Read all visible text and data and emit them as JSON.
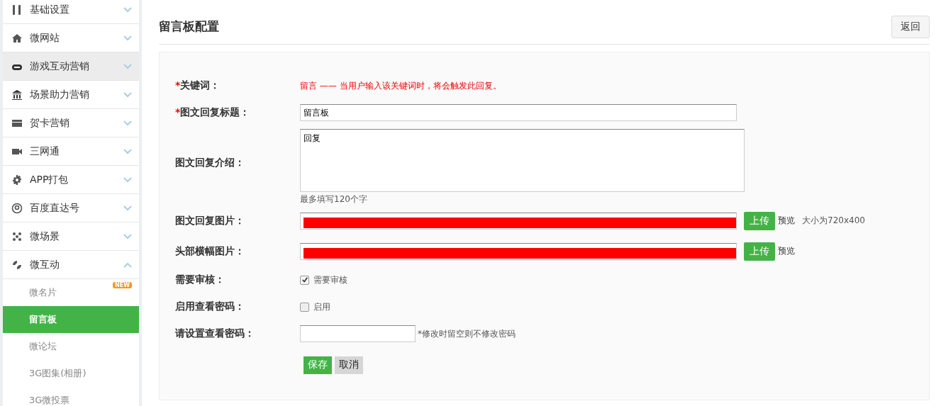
{
  "sidebar": {
    "items": [
      {
        "label": "基础设置",
        "expanded": false,
        "hovered": false
      },
      {
        "label": "微网站",
        "expanded": false,
        "hovered": false
      },
      {
        "label": "游戏互动营销",
        "expanded": false,
        "hovered": true
      },
      {
        "label": "场景助力营销",
        "expanded": false,
        "hovered": false
      },
      {
        "label": "贺卡营销",
        "expanded": false,
        "hovered": false
      },
      {
        "label": "三网通",
        "expanded": false,
        "hovered": false
      },
      {
        "label": "APP打包",
        "expanded": false,
        "hovered": false
      },
      {
        "label": "百度直达号",
        "expanded": false,
        "hovered": false
      },
      {
        "label": "微场景",
        "expanded": false,
        "hovered": false
      },
      {
        "label": "微互动",
        "expanded": true,
        "hovered": false,
        "children": [
          {
            "label": "微名片",
            "selected": false,
            "badge": "NEW"
          },
          {
            "label": "留言板",
            "selected": true
          },
          {
            "label": "微论坛",
            "selected": false
          },
          {
            "label": "3G图集(相册)",
            "selected": false
          },
          {
            "label": "3G微投票",
            "selected": false
          }
        ]
      }
    ]
  },
  "page": {
    "title": "留言板配置",
    "back_button": "返回"
  },
  "form": {
    "rows": [
      {
        "kind": "note",
        "label": "关键词：",
        "required_mark": "*",
        "keyword": "留言",
        "note": "—— 当用户输入该关键词时，将会触发此回复。"
      },
      {
        "kind": "text",
        "label": "图文回复标题：",
        "required_mark": "*",
        "value": "留言板",
        "wide": true
      },
      {
        "kind": "textarea",
        "label": "图文回复介绍：",
        "value": "回复",
        "hint": "最多填写120个字"
      },
      {
        "kind": "upload",
        "label": "图文回复图片：",
        "upload": "上传",
        "preview": "预览",
        "size_note": "大小为720x400"
      },
      {
        "kind": "upload",
        "label": "头部横幅图片：",
        "upload": "上传",
        "preview": "预览"
      },
      {
        "kind": "checkbox",
        "label": "需要审核：",
        "option": "需要审核",
        "checked": true
      },
      {
        "kind": "checkbox",
        "label": "启用查看密码：",
        "option": "启用",
        "checked": false
      },
      {
        "kind": "password",
        "label": "请设置查看密码：",
        "hint": "*修改时留空则不修改密码"
      }
    ],
    "save": "保存",
    "cancel": "取消"
  }
}
